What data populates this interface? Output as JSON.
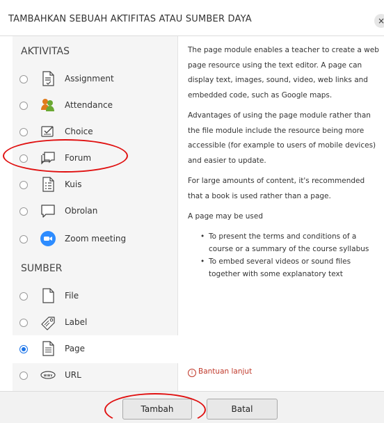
{
  "dialog": {
    "title": "TAMBAHKAN SEBUAH AKTIFITAS ATAU SUMBER DAYA",
    "close_icon": "×"
  },
  "activities": {
    "heading": "AKTIVITAS",
    "items": [
      {
        "label": "Assignment",
        "icon": "assignment-icon"
      },
      {
        "label": "Attendance",
        "icon": "attendance-icon"
      },
      {
        "label": "Choice",
        "icon": "choice-icon"
      },
      {
        "label": "Forum",
        "icon": "forum-icon"
      },
      {
        "label": "Kuis",
        "icon": "quiz-icon"
      },
      {
        "label": "Obrolan",
        "icon": "chat-icon"
      },
      {
        "label": "Zoom meeting",
        "icon": "zoom-icon"
      }
    ]
  },
  "resources": {
    "heading": "SUMBER",
    "items": [
      {
        "label": "File",
        "icon": "file-icon"
      },
      {
        "label": "Label",
        "icon": "label-icon"
      },
      {
        "label": "Page",
        "icon": "page-icon",
        "selected": true
      },
      {
        "label": "URL",
        "icon": "url-icon"
      }
    ]
  },
  "description": {
    "p1": "The page module enables a teacher to create a web page resource using the text editor. A page can display text, images, sound, video, web links and embedded code, such as Google maps.",
    "p2": "Advantages of using the page module rather than the file module include the resource being more accessible (for example to users of mobile devices) and easier to update.",
    "p3": "For large amounts of content, it's recommended that a book is used rather than a page.",
    "p4": "A page may be used",
    "bullets": [
      "To present the terms and conditions of a course or a summary of the course syllabus",
      "To embed several videos or sound files together with some explanatory text"
    ],
    "help_link": "Bantuan lanjut"
  },
  "footer": {
    "add_label": "Tambah",
    "cancel_label": "Batal"
  },
  "colors": {
    "annotation": "#e01010",
    "selected_radio": "#1a73e8",
    "zoom": "#2d8cff",
    "help_link": "#c0392b"
  }
}
